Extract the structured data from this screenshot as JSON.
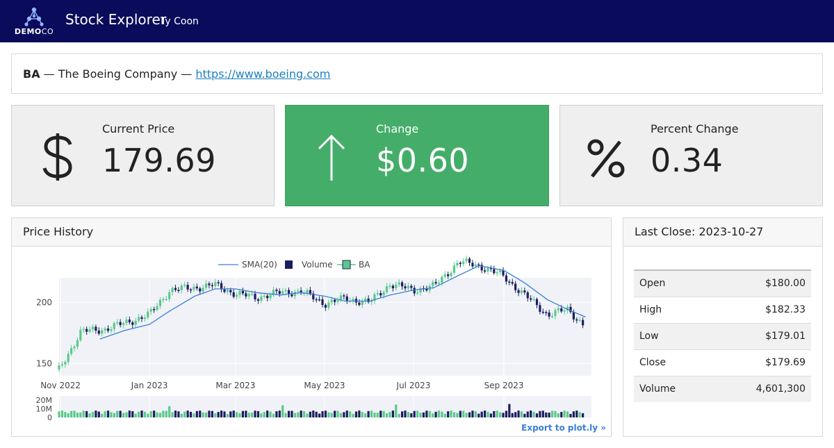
{
  "app": {
    "brand_bold": "DEMO",
    "brand_light": "CO",
    "title": "Stock Explorer",
    "user": "Ty Coon"
  },
  "company": {
    "ticker": "BA",
    "name": "The Boeing Company",
    "url": "https://www.boeing.com"
  },
  "kpis": {
    "price": {
      "label": "Current Price",
      "value": "179.69",
      "icon": "dollar-icon"
    },
    "change": {
      "label": "Change",
      "value": "$0.60",
      "icon": "arrow-up-icon",
      "color": "#45ad6a"
    },
    "percent": {
      "label": "Percent Change",
      "value": "0.34",
      "icon": "percent-icon"
    }
  },
  "price_history": {
    "title": "Price History",
    "export_label": "Export to plot.ly »"
  },
  "last_close": {
    "title": "Last Close: 2023-10-27",
    "rows": [
      {
        "label": "Open",
        "value": "$180.00"
      },
      {
        "label": "High",
        "value": "$182.33"
      },
      {
        "label": "Low",
        "value": "$179.01"
      },
      {
        "label": "Close",
        "value": "$179.69"
      },
      {
        "label": "Volume",
        "value": "4,601,300"
      }
    ]
  },
  "colors": {
    "up": "#5bc98a",
    "down": "#1b1e5e",
    "sma": "#3a7fd6",
    "nav": "#0a0b5a"
  },
  "chart_data": {
    "type": "line",
    "legend": [
      "SMA(20)",
      "Volume",
      "BA"
    ],
    "legend_position": "top-center",
    "x_ticks": [
      "Nov 2022",
      "Jan 2023",
      "Mar 2023",
      "May 2023",
      "Jul 2023",
      "Sep 2023"
    ],
    "y_ticks": [
      "150",
      "200"
    ],
    "ylim": [
      140,
      220
    ],
    "volume_ticks": [
      "20M",
      "10M",
      "0"
    ],
    "volume_ylim": [
      0,
      25
    ],
    "series": [
      {
        "name": "BA",
        "kind": "candlestick",
        "x": [
          "2022-10-31",
          "2022-11-15",
          "2022-12-01",
          "2022-12-15",
          "2023-01-01",
          "2023-01-15",
          "2023-02-01",
          "2023-02-15",
          "2023-03-01",
          "2023-03-15",
          "2023-04-01",
          "2023-04-15",
          "2023-05-01",
          "2023-05-15",
          "2023-06-01",
          "2023-06-15",
          "2023-07-01",
          "2023-07-15",
          "2023-08-01",
          "2023-08-15",
          "2023-09-01",
          "2023-09-15",
          "2023-10-01",
          "2023-10-15",
          "2023-10-27"
        ],
        "close": [
          145,
          176,
          178,
          183,
          190,
          210,
          212,
          214,
          207,
          204,
          208,
          209,
          199,
          203,
          200,
          215,
          210,
          213,
          233,
          230,
          221,
          206,
          190,
          194,
          180
        ]
      },
      {
        "name": "SMA(20)",
        "kind": "line",
        "x": [
          "2022-11-28",
          "2022-12-15",
          "2023-01-01",
          "2023-01-15",
          "2023-02-01",
          "2023-02-15",
          "2023-03-01",
          "2023-03-15",
          "2023-04-01",
          "2023-04-15",
          "2023-05-01",
          "2023-05-15",
          "2023-06-01",
          "2023-06-15",
          "2023-07-01",
          "2023-07-15",
          "2023-08-01",
          "2023-08-15",
          "2023-09-01",
          "2023-09-15",
          "2023-10-01",
          "2023-10-15",
          "2023-10-27"
        ],
        "values": [
          170,
          177,
          182,
          193,
          205,
          211,
          211,
          208,
          206,
          208,
          205,
          201,
          201,
          206,
          210,
          212,
          222,
          230,
          226,
          216,
          202,
          194,
          188
        ]
      },
      {
        "name": "Volume",
        "kind": "bar",
        "unit": "M",
        "x": [
          "2022-11-01",
          "2022-12-01",
          "2023-01-01",
          "2023-02-01",
          "2023-03-01",
          "2023-04-01",
          "2023-05-01",
          "2023-06-01",
          "2023-07-01",
          "2023-08-01",
          "2023-09-01",
          "2023-10-01",
          "2023-10-27"
        ],
        "values": [
          9,
          6,
          5,
          6,
          7,
          20,
          5,
          6,
          7,
          22,
          6,
          6,
          13
        ]
      }
    ]
  }
}
